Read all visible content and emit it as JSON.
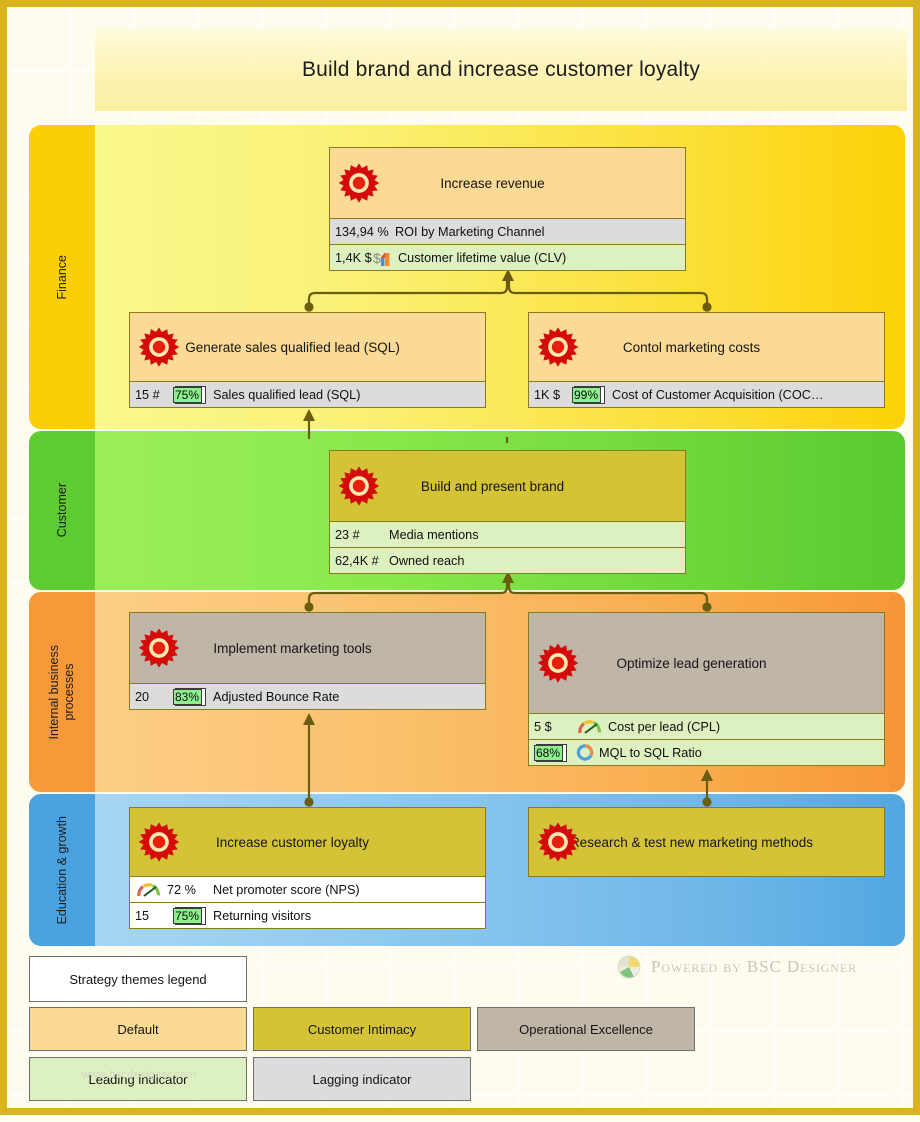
{
  "title": "Build brand and increase customer loyalty",
  "perspectives": [
    {
      "label": "Finance"
    },
    {
      "label": "Customer"
    },
    {
      "label": "Internal business\nprocesses"
    },
    {
      "label": "Education & growth"
    }
  ],
  "goals": [
    {
      "name": "Increase revenue",
      "theme": "Default",
      "indicators": [
        {
          "value": "134,94 %",
          "badge": "",
          "name": "ROI by Marketing Channel",
          "kind": "Lagging",
          "icon": ""
        },
        {
          "value": "1,4K $",
          "badge": "",
          "name": "Customer lifetime value (CLV)",
          "kind": "Leading",
          "icon": "money-chart-icon"
        }
      ]
    },
    {
      "name": "Generate sales qualified lead (SQL)",
      "theme": "Default",
      "indicators": [
        {
          "value": "15 #",
          "badge": "75%",
          "name": "Sales qualified lead (SQL)",
          "kind": "Lagging",
          "icon": ""
        }
      ]
    },
    {
      "name": "Contol marketing costs",
      "theme": "Default",
      "indicators": [
        {
          "value": "1K $",
          "badge": "99%",
          "name": "Cost of Customer Acquisition (COC…",
          "kind": "Lagging",
          "icon": ""
        }
      ]
    },
    {
      "name": "Build and present brand",
      "theme": "Customer Intimacy",
      "indicators": [
        {
          "value": "23 #",
          "badge": "",
          "name": "Media mentions",
          "kind": "Leading",
          "icon": ""
        },
        {
          "value": "62,4K #",
          "badge": "",
          "name": "Owned reach",
          "kind": "Leading",
          "icon": ""
        }
      ]
    },
    {
      "name": "Implement marketing tools",
      "theme": "Operational Excellence",
      "indicators": [
        {
          "value": "20",
          "badge": "83%",
          "name": "Adjusted Bounce Rate",
          "kind": "Lagging",
          "icon": ""
        }
      ]
    },
    {
      "name": "Optimize lead generation",
      "theme": "Operational Excellence",
      "indicators": [
        {
          "value": "5 $",
          "badge": "",
          "name": "Cost per lead (CPL)",
          "kind": "Leading",
          "icon": "gauge-icon"
        },
        {
          "value": "",
          "badge": "68%",
          "name": "MQL to SQL Ratio",
          "kind": "Leading",
          "icon": "donut-icon"
        }
      ]
    },
    {
      "name": "Increase customer loyalty",
      "theme": "Customer Intimacy",
      "indicators": [
        {
          "value": "72 %",
          "badge": "",
          "name": "Net promoter score (NPS)",
          "kind": "Leading",
          "icon": "gauge-icon"
        },
        {
          "value": "15",
          "badge": "75%",
          "name": "Returning visitors",
          "kind": "Leading",
          "icon": ""
        }
      ]
    },
    {
      "name": "Research & test new marketing methods",
      "theme": "Customer Intimacy",
      "indicators": []
    }
  ],
  "legend": {
    "title": "Strategy themes legend",
    "default": "Default",
    "intimacy": "Customer Intimacy",
    "opex": "Operational Excellence",
    "leading": "Leading indicator",
    "lagging": "Lagging indicator"
  },
  "watermark": "www.bscdesigner.com",
  "brand": "Powered by BSC Designer",
  "colors": {
    "finance": "#FBCE05",
    "customer": "#5FCB33",
    "internal": "#F79839",
    "education": "#4AA3DE",
    "default_theme": "#FBDA95",
    "intimacy_theme": "#D4C337",
    "opex_theme": "#BFB6A8",
    "leading_row": "#DCF0C0",
    "lagging_row": "#DCDCDC",
    "badge_green": "#8CF08C",
    "link": "#6B5D10",
    "frame": "#D8B520"
  }
}
